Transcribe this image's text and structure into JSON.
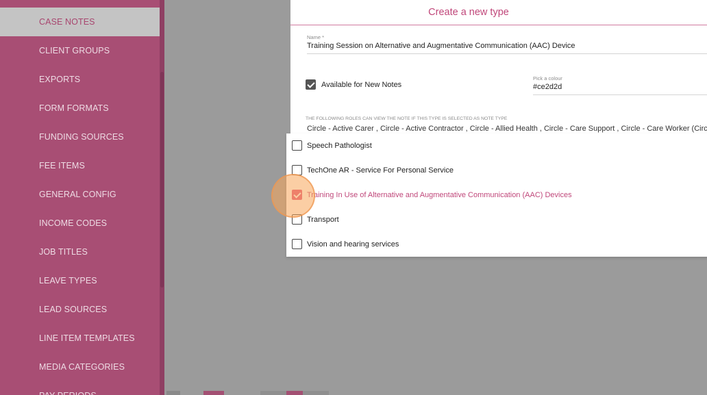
{
  "sidebar": {
    "items": [
      {
        "label": "CASE NOTES",
        "active": true
      },
      {
        "label": "CLIENT GROUPS"
      },
      {
        "label": "EXPORTS"
      },
      {
        "label": "FORM FORMATS"
      },
      {
        "label": "FUNDING SOURCES"
      },
      {
        "label": "FEE ITEMS"
      },
      {
        "label": "GENERAL CONFIG"
      },
      {
        "label": "INCOME CODES"
      },
      {
        "label": "JOB TITLES"
      },
      {
        "label": "LEAVE TYPES"
      },
      {
        "label": "LEAD SOURCES"
      },
      {
        "label": "LINE ITEM TEMPLATES"
      },
      {
        "label": "MEDIA CATEGORIES"
      },
      {
        "label": "PAY PERIODS"
      }
    ]
  },
  "modal": {
    "title": "Create a new type",
    "name_label": "Name *",
    "name_value": "Training Session on Alternative and Augmentative Communication (AAC) Device",
    "available_label": "Available for New Notes",
    "available_checked": true,
    "colour_label": "Pick a colour",
    "colour_value": "#ce2d2d",
    "roles_label": "THE FOLLOWING ROLES CAN VIEW THE NOTE IF THIS TYPE IS SELECTED AS NOTE TYPE",
    "roles_value": "Circle - Active Carer , Circle - Active Contractor , Circle - Allied Health , Circle - Care Support , Circle - Care Worker (Circle) ,"
  },
  "dropdown": {
    "options": [
      {
        "label": "Speech Pathologist",
        "checked": false
      },
      {
        "label": "TechOne AR - Service For Personal Service",
        "checked": false
      },
      {
        "label": "Training In Use of Alternative and Augmentative Communication (AAC) Devices",
        "checked": true
      },
      {
        "label": "Transport",
        "checked": false
      },
      {
        "label": "Vision and hearing services",
        "checked": false
      }
    ]
  },
  "colors": {
    "sidebar_bg": "#a84e74",
    "accent": "#c0477a",
    "checkbox_selected": "#e3527e",
    "backdrop": "#9b9b9b"
  }
}
